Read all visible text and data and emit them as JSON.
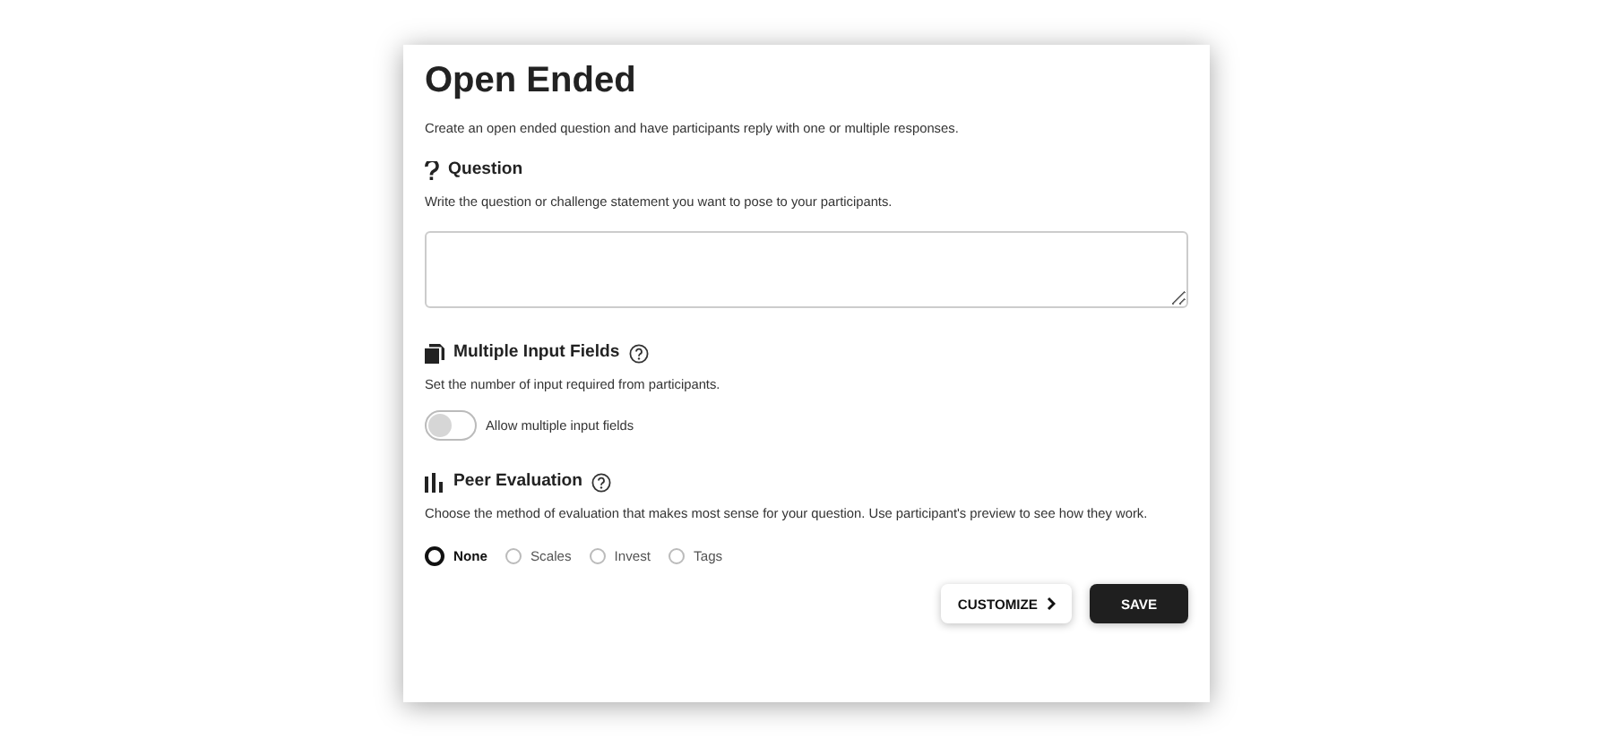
{
  "title": "Open Ended",
  "description": "Create an open ended question and have participants reply with one or multiple responses.",
  "sections": [
    {
      "kind": "question",
      "heading": "Question",
      "help": false,
      "description": "Write the question or challenge statement you want to pose to your participants."
    },
    {
      "kind": "toggle",
      "heading": "Multiple Input Fields",
      "help": true,
      "description": "Set the number of input required from participants.",
      "toggle": {
        "label": "Allow multiple input fields",
        "on": false
      }
    },
    {
      "kind": "radios",
      "heading": "Peer Evaluation",
      "help": true,
      "description": "Choose the method of evaluation that makes most sense for your question.  Use participant's preview to see how they work.",
      "options": [
        {
          "label": "None",
          "selected": true
        },
        {
          "label": "Scales",
          "selected": false
        },
        {
          "label": "Invest",
          "selected": false
        },
        {
          "label": "Tags",
          "selected": false
        }
      ]
    }
  ],
  "buttons": [
    {
      "label": "CUSTOMIZE",
      "kind": "secondary"
    },
    {
      "label": "SAVE",
      "kind": "primary"
    }
  ]
}
